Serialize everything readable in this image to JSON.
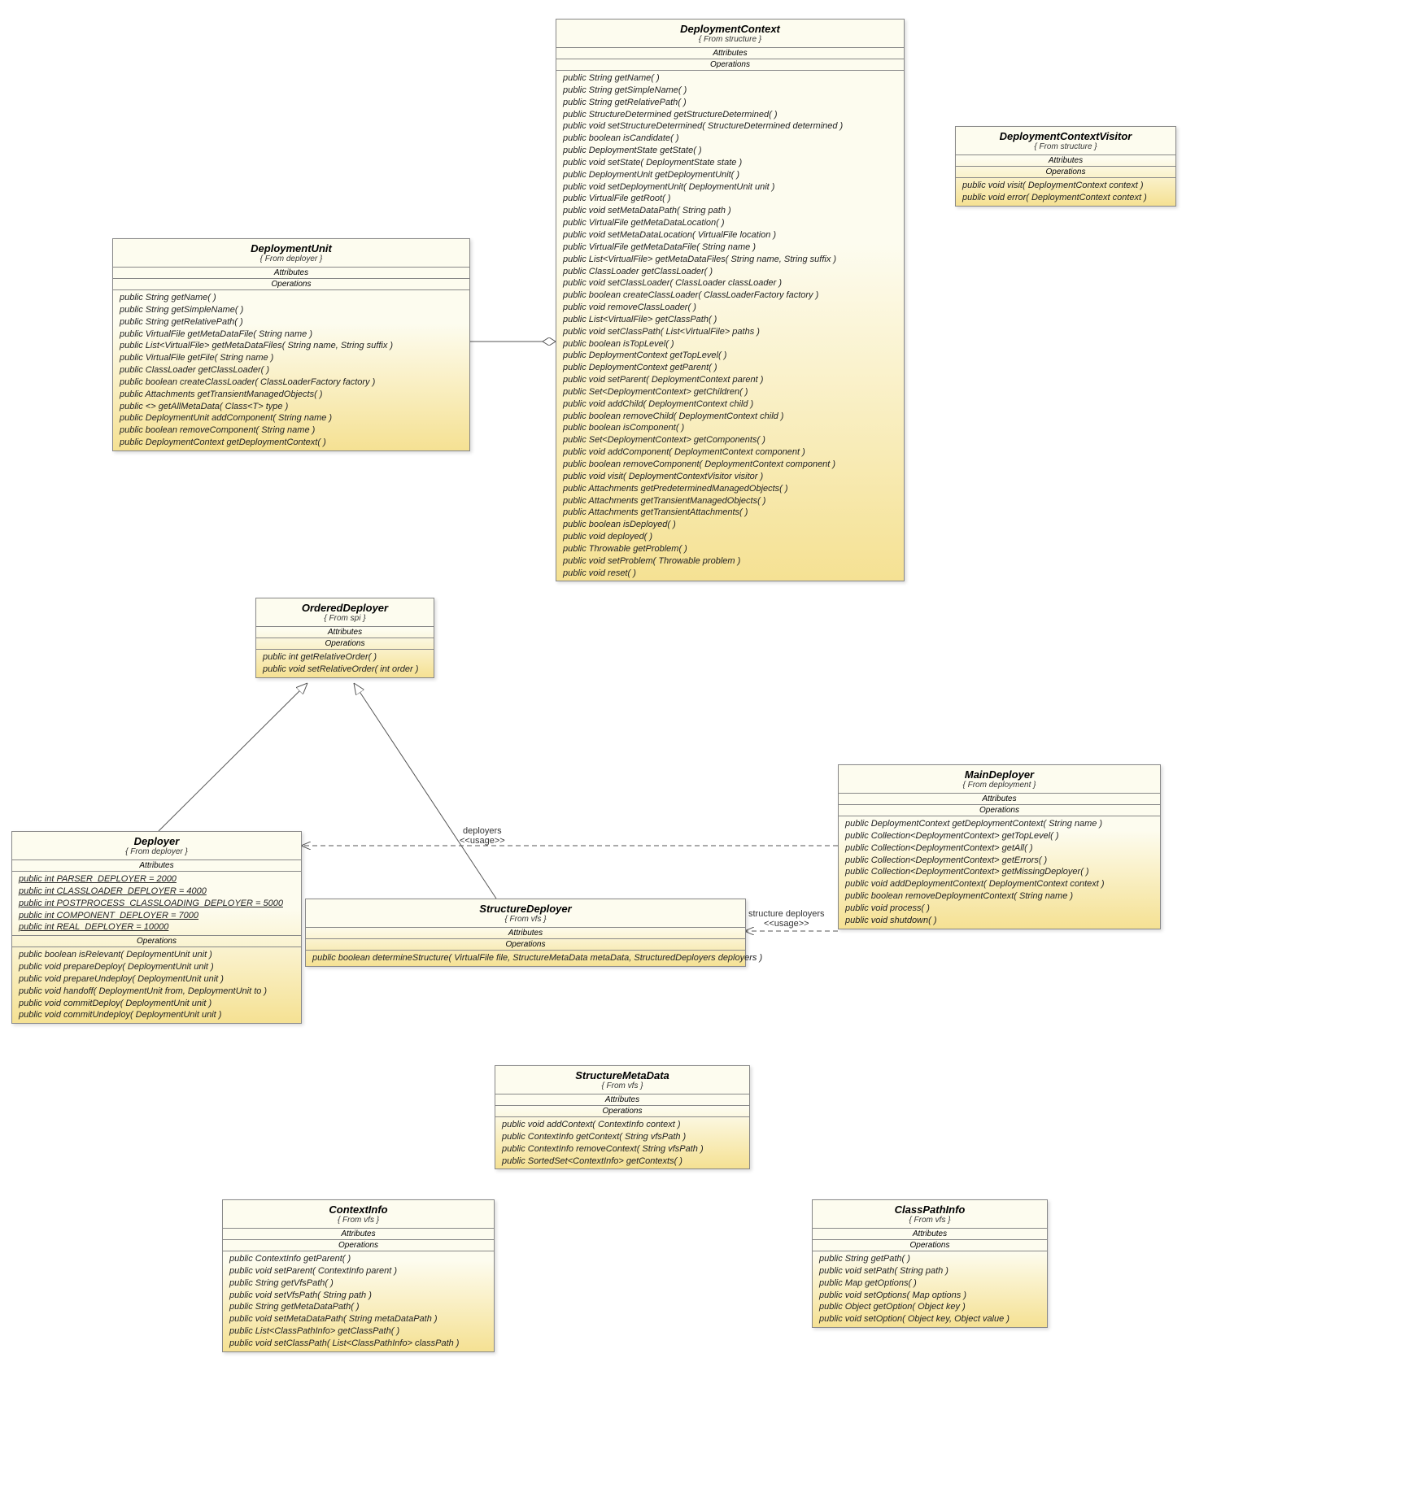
{
  "classes": {
    "DeploymentContext": {
      "name": "DeploymentContext",
      "from": "{ From structure }",
      "attrs": [],
      "ops": [
        "public String  getName( )",
        "public String  getSimpleName( )",
        "public String  getRelativePath( )",
        "public StructureDetermined  getStructureDetermined( )",
        "public void  setStructureDetermined( StructureDetermined determined )",
        "public boolean  isCandidate( )",
        "public DeploymentState  getState( )",
        "public void  setState( DeploymentState state )",
        "public DeploymentUnit  getDeploymentUnit( )",
        "public void  setDeploymentUnit( DeploymentUnit unit )",
        "public VirtualFile  getRoot( )",
        "public void  setMetaDataPath( String path )",
        "public VirtualFile  getMetaDataLocation( )",
        "public void  setMetaDataLocation( VirtualFile location )",
        "public VirtualFile  getMetaDataFile( String name )",
        "public List<VirtualFile>  getMetaDataFiles( String name, String suffix )",
        "public ClassLoader  getClassLoader( )",
        "public void  setClassLoader( ClassLoader classLoader )",
        "public boolean  createClassLoader( ClassLoaderFactory factory )",
        "public void  removeClassLoader( )",
        "public List<VirtualFile>  getClassPath( )",
        "public void  setClassPath( List<VirtualFile> paths )",
        "public boolean  isTopLevel( )",
        "public DeploymentContext  getTopLevel( )",
        "public DeploymentContext  getParent( )",
        "public void  setParent( DeploymentContext parent )",
        "public Set<DeploymentContext>  getChildren( )",
        "public void  addChild( DeploymentContext child )",
        "public boolean  removeChild( DeploymentContext child )",
        "public boolean  isComponent( )",
        "public Set<DeploymentContext>  getComponents( )",
        "public void  addComponent( DeploymentContext component )",
        "public boolean  removeComponent( DeploymentContext component )",
        "public void  visit( DeploymentContextVisitor visitor )",
        "public Attachments  getPredeterminedManagedObjects( )",
        "public Attachments  getTransientManagedObjects( )",
        "public Attachments  getTransientAttachments( )",
        "public boolean  isDeployed( )",
        "public void  deployed( )",
        "public Throwable  getProblem( )",
        "public void  setProblem( Throwable problem )",
        "public void  reset( )"
      ]
    },
    "DeploymentContextVisitor": {
      "name": "DeploymentContextVisitor",
      "from": "{ From structure }",
      "attrs": [],
      "ops": [
        "public void  visit( DeploymentContext context )",
        "public void  error( DeploymentContext context )"
      ]
    },
    "DeploymentUnit": {
      "name": "DeploymentUnit",
      "from": "{ From deployer }",
      "attrs": [],
      "ops": [
        "public String  getName( )",
        "public String  getSimpleName( )",
        "public String  getRelativePath( )",
        "public VirtualFile  getMetaDataFile( String name )",
        "public List<VirtualFile>  getMetaDataFiles( String name, String suffix )",
        "public VirtualFile  getFile( String name )",
        "public ClassLoader  getClassLoader( )",
        "public boolean  createClassLoader( ClassLoaderFactory factory )",
        "public Attachments  getTransientManagedObjects( )",
        "public <>   getAllMetaData( Class<T> type )",
        "public DeploymentUnit  addComponent( String name )",
        "public boolean  removeComponent( String name )",
        "public DeploymentContext  getDeploymentContext( )"
      ]
    },
    "OrderedDeployer": {
      "name": "OrderedDeployer",
      "from": "{ From spi }",
      "attrs": [],
      "ops": [
        "public int  getRelativeOrder( )",
        "public void  setRelativeOrder( int order )"
      ]
    },
    "MainDeployer": {
      "name": "MainDeployer",
      "from": "{ From deployment }",
      "attrs": [],
      "ops": [
        "public DeploymentContext  getDeploymentContext( String name )",
        "public Collection<DeploymentContext>  getTopLevel( )",
        "public Collection<DeploymentContext>  getAll( )",
        "public Collection<DeploymentContext>  getErrors( )",
        "public Collection<DeploymentContext>  getMissingDeployer( )",
        "public void  addDeploymentContext( DeploymentContext context )",
        "public boolean  removeDeploymentContext( String name )",
        "public void  process( )",
        "public void  shutdown( )"
      ]
    },
    "Deployer": {
      "name": "Deployer",
      "from": "{ From deployer }",
      "attrs": [
        "public int PARSER_DEPLOYER = 2000",
        "public int CLASSLOADER_DEPLOYER = 4000",
        "public int POSTPROCESS_CLASSLOADING_DEPLOYER = 5000",
        "public int COMPONENT_DEPLOYER = 7000",
        "public int REAL_DEPLOYER = 10000"
      ],
      "ops": [
        "public boolean  isRelevant( DeploymentUnit unit )",
        "public void  prepareDeploy( DeploymentUnit unit )",
        "public void  prepareUndeploy( DeploymentUnit unit )",
        "public void  handoff( DeploymentUnit from, DeploymentUnit to )",
        "public void  commitDeploy( DeploymentUnit unit )",
        "public void  commitUndeploy( DeploymentUnit unit )"
      ]
    },
    "StructureDeployer": {
      "name": "StructureDeployer",
      "from": "{ From vfs }",
      "attrs": [],
      "ops": [
        "public boolean  determineStructure( VirtualFile file, StructureMetaData metaData, StructuredDeployers deployers )"
      ]
    },
    "StructureMetaData": {
      "name": "StructureMetaData",
      "from": "{ From vfs }",
      "attrs": [],
      "ops": [
        "public void  addContext( ContextInfo context )",
        "public ContextInfo  getContext( String vfsPath )",
        "public ContextInfo  removeContext( String vfsPath )",
        "public SortedSet<ContextInfo>  getContexts( )"
      ]
    },
    "ContextInfo": {
      "name": "ContextInfo",
      "from": "{ From vfs }",
      "attrs": [],
      "ops": [
        "public ContextInfo  getParent( )",
        "public void  setParent( ContextInfo parent )",
        "public String  getVfsPath( )",
        "public void  setVfsPath( String path )",
        "public String  getMetaDataPath( )",
        "public void  setMetaDataPath( String metaDataPath )",
        "public List<ClassPathInfo>  getClassPath( )",
        "public void  setClassPath( List<ClassPathInfo> classPath )"
      ]
    },
    "ClassPathInfo": {
      "name": "ClassPathInfo",
      "from": "{ From vfs }",
      "attrs": [],
      "ops": [
        "public String  getPath( )",
        "public void  setPath( String path )",
        "public Map  getOptions( )",
        "public void  setOptions( Map options )",
        "public Object  getOption( Object key )",
        "public void  setOption( Object key, Object value )"
      ]
    }
  },
  "sections": {
    "attributes": "Attributes",
    "operations": "Operations"
  },
  "edgeLabels": {
    "deployersUsage": {
      "line1": "deployers",
      "line2": "<<usage>>"
    },
    "structureDeployersUsage": {
      "line1": "structure deployers",
      "line2": "<<usage>>"
    }
  }
}
